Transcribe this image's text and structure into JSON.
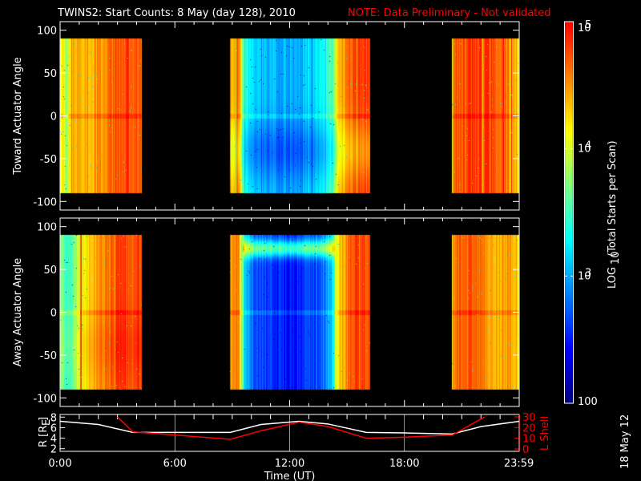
{
  "title": {
    "main": "TWINS2: Start Counts:  8 May (day 128), 2010",
    "note": "NOTE: Data Preliminary - Not validated",
    "note_color": "#ff0000"
  },
  "side_date": "18 May 12",
  "chart_data": {
    "type": "heatmap",
    "x": {
      "label": "Time (UT)",
      "range_hours": [
        0,
        24
      ],
      "tick_hours": [
        0,
        6,
        12,
        18,
        23.983
      ],
      "tick_labels": [
        "0:00",
        "6:00",
        "12:00",
        "18:00",
        "23:59"
      ]
    },
    "colorbar": {
      "label": "LOG10(Total Starts per Scan)",
      "label_parts": [
        "LOG",
        "10",
        "(Total Starts per Scan)"
      ],
      "log_range": [
        2,
        5
      ],
      "ticks": [
        {
          "log": 5,
          "base": "10",
          "exp": "5"
        },
        {
          "log": 4,
          "base": "10",
          "exp": "4"
        },
        {
          "log": 3,
          "base": "10",
          "exp": "3"
        },
        {
          "log": 2,
          "text": "100"
        }
      ],
      "colors": [
        "#000080",
        "#0000ff",
        "#0080ff",
        "#00ffff",
        "#80ff80",
        "#ffff00",
        "#ff8000",
        "#ff0000"
      ]
    },
    "panels": [
      {
        "name": "toward",
        "ylabel": "Toward Actuator Angle",
        "ylim": [
          -110,
          110
        ],
        "data_angle_range": [
          -90,
          90
        ],
        "yticks": [
          100,
          50,
          0,
          -50,
          -100
        ],
        "segments": [
          {
            "start": 0.0,
            "end": 4.27,
            "profile": [
              [
                0,
                4.3
              ],
              [
                0.3,
                3.8
              ],
              [
                0.6,
                4.5
              ],
              [
                1.5,
                4.4
              ],
              [
                2.5,
                4.6
              ],
              [
                3.5,
                4.8
              ],
              [
                4.27,
                4.7
              ]
            ],
            "angle_mod": 0.0
          },
          {
            "start": 8.9,
            "end": 16.2,
            "profile": [
              [
                8.9,
                4.4
              ],
              [
                9.3,
                4.7
              ],
              [
                9.6,
                3.4
              ],
              [
                10.2,
                3.1
              ],
              [
                12,
                3.0
              ],
              [
                13.5,
                3.2
              ],
              [
                14.2,
                3.6
              ],
              [
                14.6,
                4.4
              ],
              [
                15.2,
                4.7
              ],
              [
                16.2,
                4.8
              ]
            ],
            "angle_mod": -0.3
          },
          {
            "start": 20.5,
            "end": 24.0,
            "profile": [
              [
                20.5,
                4.6
              ],
              [
                21.5,
                4.8
              ],
              [
                23,
                4.7
              ],
              [
                23.7,
                4.5
              ],
              [
                24,
                4.2
              ]
            ],
            "angle_mod": 0.0
          }
        ]
      },
      {
        "name": "away",
        "ylabel": "Away Actuator Angle",
        "ylim": [
          -110,
          110
        ],
        "data_angle_range": [
          -90,
          90
        ],
        "yticks": [
          100,
          50,
          0,
          -50,
          -100
        ],
        "segments": [
          {
            "start": 0.0,
            "end": 4.27,
            "profile": [
              [
                0,
                3.8
              ],
              [
                0.4,
                3.4
              ],
              [
                1.2,
                4.2
              ],
              [
                2.2,
                4.5
              ],
              [
                3.2,
                4.8
              ],
              [
                4.27,
                4.7
              ]
            ],
            "angle_mod": 0.1
          },
          {
            "start": 8.9,
            "end": 16.2,
            "profile": [
              [
                8.9,
                4.4
              ],
              [
                9.3,
                4.6
              ],
              [
                9.6,
                3.2
              ],
              [
                10.2,
                2.7
              ],
              [
                12,
                2.5
              ],
              [
                13.5,
                2.7
              ],
              [
                14.2,
                3.2
              ],
              [
                14.6,
                4.3
              ],
              [
                15.2,
                4.7
              ],
              [
                16.2,
                4.8
              ]
            ],
            "angle_mod": 0.0,
            "band_angle": 75,
            "band_boost": 1.0
          },
          {
            "start": 20.5,
            "end": 24.0,
            "profile": [
              [
                20.5,
                4.6
              ],
              [
                21.5,
                4.7
              ],
              [
                22.5,
                4.4
              ],
              [
                23.5,
                4.5
              ],
              [
                24,
                4.3
              ]
            ],
            "angle_mod": 0.0
          }
        ]
      }
    ],
    "orbit": {
      "left_label": "R [RE]",
      "left_label_parts": [
        "R [R",
        "E",
        "]"
      ],
      "right_label": "L Shell",
      "left_range": [
        1.5,
        8.5
      ],
      "left_ticks": [
        8,
        6,
        4,
        2
      ],
      "right_range": [
        0,
        30
      ],
      "right_ticks": [
        30,
        20,
        10,
        0
      ],
      "series": [
        {
          "name": "R",
          "color": "#ffffff",
          "axis": "left",
          "points": [
            [
              0,
              7.2
            ],
            [
              2,
              6.6
            ],
            [
              3.8,
              5.1
            ],
            [
              8.9,
              5.1
            ],
            [
              10.5,
              6.6
            ],
            [
              12.5,
              7.2
            ],
            [
              14,
              6.7
            ],
            [
              16,
              5.1
            ],
            [
              18,
              5.0
            ],
            [
              20.5,
              4.8
            ],
            [
              22,
              6.2
            ],
            [
              24,
              7.2
            ]
          ]
        },
        {
          "name": "L Shell",
          "color": "#ff0000",
          "axis": "right",
          "points": [
            [
              3.0,
              30
            ],
            [
              3.8,
              16
            ],
            [
              6,
              13
            ],
            [
              8.9,
              9
            ],
            [
              10.5,
              17
            ],
            [
              12.5,
              25
            ],
            [
              14,
              21
            ],
            [
              16,
              10
            ],
            [
              18,
              11
            ],
            [
              20.5,
              13
            ],
            [
              22.2,
              30
            ]
          ]
        }
      ]
    }
  }
}
